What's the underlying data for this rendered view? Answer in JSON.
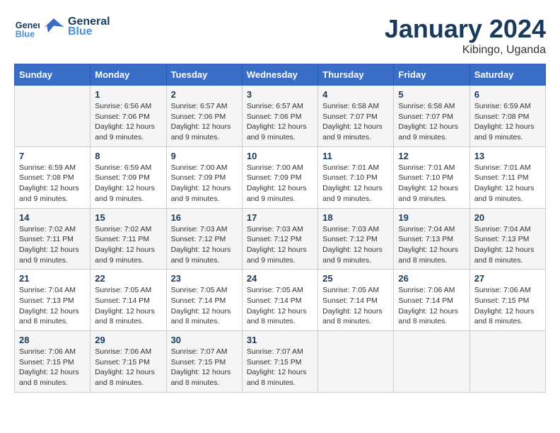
{
  "header": {
    "logo_line1": "General",
    "logo_line2": "Blue",
    "month": "January 2024",
    "location": "Kibingo, Uganda"
  },
  "days_of_week": [
    "Sunday",
    "Monday",
    "Tuesday",
    "Wednesday",
    "Thursday",
    "Friday",
    "Saturday"
  ],
  "weeks": [
    [
      {
        "day": "",
        "info": ""
      },
      {
        "day": "1",
        "info": "Sunrise: 6:56 AM\nSunset: 7:06 PM\nDaylight: 12 hours\nand 9 minutes."
      },
      {
        "day": "2",
        "info": "Sunrise: 6:57 AM\nSunset: 7:06 PM\nDaylight: 12 hours\nand 9 minutes."
      },
      {
        "day": "3",
        "info": "Sunrise: 6:57 AM\nSunset: 7:06 PM\nDaylight: 12 hours\nand 9 minutes."
      },
      {
        "day": "4",
        "info": "Sunrise: 6:58 AM\nSunset: 7:07 PM\nDaylight: 12 hours\nand 9 minutes."
      },
      {
        "day": "5",
        "info": "Sunrise: 6:58 AM\nSunset: 7:07 PM\nDaylight: 12 hours\nand 9 minutes."
      },
      {
        "day": "6",
        "info": "Sunrise: 6:59 AM\nSunset: 7:08 PM\nDaylight: 12 hours\nand 9 minutes."
      }
    ],
    [
      {
        "day": "7",
        "info": "Sunrise: 6:59 AM\nSunset: 7:08 PM\nDaylight: 12 hours\nand 9 minutes."
      },
      {
        "day": "8",
        "info": "Sunrise: 6:59 AM\nSunset: 7:09 PM\nDaylight: 12 hours\nand 9 minutes."
      },
      {
        "day": "9",
        "info": "Sunrise: 7:00 AM\nSunset: 7:09 PM\nDaylight: 12 hours\nand 9 minutes."
      },
      {
        "day": "10",
        "info": "Sunrise: 7:00 AM\nSunset: 7:09 PM\nDaylight: 12 hours\nand 9 minutes."
      },
      {
        "day": "11",
        "info": "Sunrise: 7:01 AM\nSunset: 7:10 PM\nDaylight: 12 hours\nand 9 minutes."
      },
      {
        "day": "12",
        "info": "Sunrise: 7:01 AM\nSunset: 7:10 PM\nDaylight: 12 hours\nand 9 minutes."
      },
      {
        "day": "13",
        "info": "Sunrise: 7:01 AM\nSunset: 7:11 PM\nDaylight: 12 hours\nand 9 minutes."
      }
    ],
    [
      {
        "day": "14",
        "info": "Sunrise: 7:02 AM\nSunset: 7:11 PM\nDaylight: 12 hours\nand 9 minutes."
      },
      {
        "day": "15",
        "info": "Sunrise: 7:02 AM\nSunset: 7:11 PM\nDaylight: 12 hours\nand 9 minutes."
      },
      {
        "day": "16",
        "info": "Sunrise: 7:03 AM\nSunset: 7:12 PM\nDaylight: 12 hours\nand 9 minutes."
      },
      {
        "day": "17",
        "info": "Sunrise: 7:03 AM\nSunset: 7:12 PM\nDaylight: 12 hours\nand 9 minutes."
      },
      {
        "day": "18",
        "info": "Sunrise: 7:03 AM\nSunset: 7:12 PM\nDaylight: 12 hours\nand 9 minutes."
      },
      {
        "day": "19",
        "info": "Sunrise: 7:04 AM\nSunset: 7:13 PM\nDaylight: 12 hours\nand 8 minutes."
      },
      {
        "day": "20",
        "info": "Sunrise: 7:04 AM\nSunset: 7:13 PM\nDaylight: 12 hours\nand 8 minutes."
      }
    ],
    [
      {
        "day": "21",
        "info": "Sunrise: 7:04 AM\nSunset: 7:13 PM\nDaylight: 12 hours\nand 8 minutes."
      },
      {
        "day": "22",
        "info": "Sunrise: 7:05 AM\nSunset: 7:14 PM\nDaylight: 12 hours\nand 8 minutes."
      },
      {
        "day": "23",
        "info": "Sunrise: 7:05 AM\nSunset: 7:14 PM\nDaylight: 12 hours\nand 8 minutes."
      },
      {
        "day": "24",
        "info": "Sunrise: 7:05 AM\nSunset: 7:14 PM\nDaylight: 12 hours\nand 8 minutes."
      },
      {
        "day": "25",
        "info": "Sunrise: 7:05 AM\nSunset: 7:14 PM\nDaylight: 12 hours\nand 8 minutes."
      },
      {
        "day": "26",
        "info": "Sunrise: 7:06 AM\nSunset: 7:14 PM\nDaylight: 12 hours\nand 8 minutes."
      },
      {
        "day": "27",
        "info": "Sunrise: 7:06 AM\nSunset: 7:15 PM\nDaylight: 12 hours\nand 8 minutes."
      }
    ],
    [
      {
        "day": "28",
        "info": "Sunrise: 7:06 AM\nSunset: 7:15 PM\nDaylight: 12 hours\nand 8 minutes."
      },
      {
        "day": "29",
        "info": "Sunrise: 7:06 AM\nSunset: 7:15 PM\nDaylight: 12 hours\nand 8 minutes."
      },
      {
        "day": "30",
        "info": "Sunrise: 7:07 AM\nSunset: 7:15 PM\nDaylight: 12 hours\nand 8 minutes."
      },
      {
        "day": "31",
        "info": "Sunrise: 7:07 AM\nSunset: 7:15 PM\nDaylight: 12 hours\nand 8 minutes."
      },
      {
        "day": "",
        "info": ""
      },
      {
        "day": "",
        "info": ""
      },
      {
        "day": "",
        "info": ""
      }
    ]
  ]
}
